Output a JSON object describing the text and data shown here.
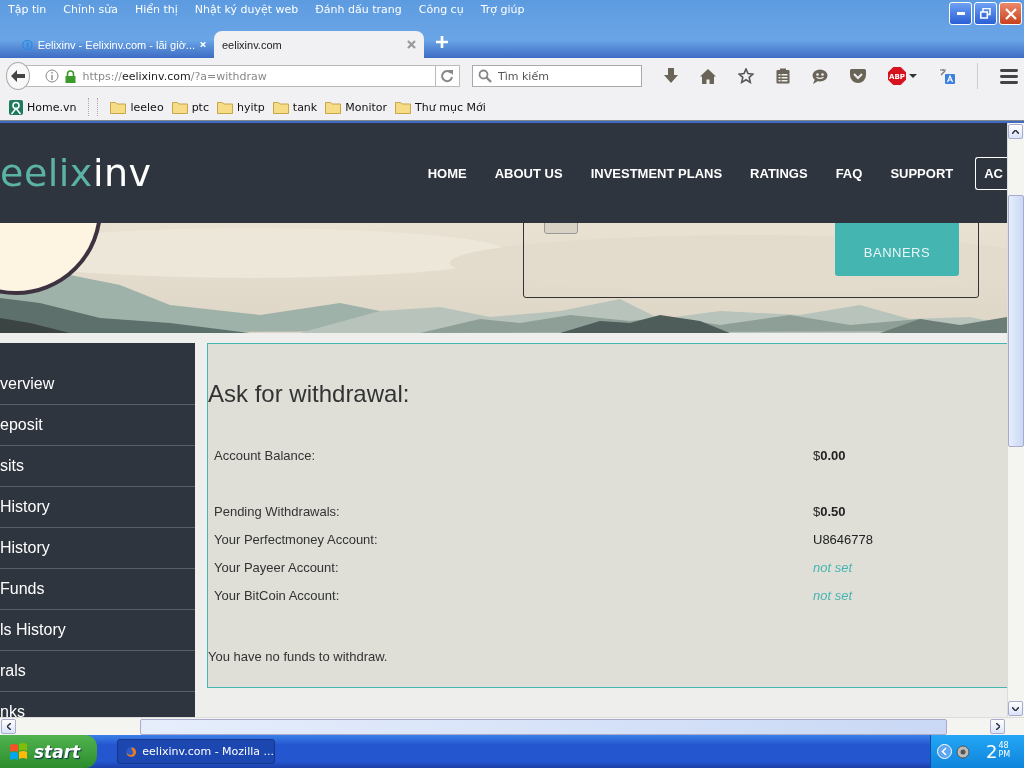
{
  "window": {
    "menus": [
      "Tập tin",
      "Chỉnh sửa",
      "Hiển thị",
      "Nhật ký duyệt web",
      "Đánh dấu trang",
      "Công cụ",
      "Trợ giúp"
    ]
  },
  "tabs": [
    {
      "label": "Eelixinv - Eelixinv.com - lãi giờ...",
      "selected": false
    },
    {
      "label": "eelixinv.com",
      "selected": true
    }
  ],
  "address_bar": {
    "scheme": "https://",
    "host": "eelixinv.com",
    "path": "/?a=withdraw"
  },
  "search": {
    "placeholder": "Tìm kiếm"
  },
  "toolbar": {
    "adblock_label": "ABP"
  },
  "bookmarks": [
    {
      "label": "Home.vn",
      "kind": "site"
    },
    {
      "label": "leeleo",
      "kind": "folder"
    },
    {
      "label": "ptc",
      "kind": "folder"
    },
    {
      "label": "hyitp",
      "kind": "folder"
    },
    {
      "label": "tank",
      "kind": "folder"
    },
    {
      "label": "Monitor",
      "kind": "folder"
    },
    {
      "label": "Thư mục Mới",
      "kind": "folder"
    }
  ],
  "site": {
    "logo_primary": "eelix",
    "logo_secondary": "inv",
    "nav": [
      "HOME",
      "ABOUT US",
      "INVESTMENT PLANS",
      "RATINGS",
      "FAQ",
      "SUPPORT"
    ],
    "account_button": "AC",
    "banners_button": "BANNERS"
  },
  "sidebar": {
    "items": [
      "verview",
      "eposit",
      "sits",
      "History",
      "History",
      "Funds",
      "ls History",
      "rals",
      "nks"
    ]
  },
  "withdraw": {
    "title": "Ask for withdrawal:",
    "rows": [
      {
        "label": "Account Balance:",
        "value": "$**0.00**",
        "kind": "amount"
      },
      {
        "label": "Pending Withdrawals:",
        "value": "$**0.50**",
        "kind": "amount"
      },
      {
        "label": "Your Perfectmoney Account:",
        "value": "U8646778",
        "kind": "text"
      },
      {
        "label": "Your Payeer Account:",
        "value": "not set",
        "kind": "unset"
      },
      {
        "label": "Your BitCoin Account:",
        "value": "not set",
        "kind": "unset"
      }
    ],
    "message": "You have no funds to withdraw."
  },
  "taskbar": {
    "start": "start",
    "tasks": [
      {
        "label": "eelixinv.com - Mozilla ...",
        "selected": true
      }
    ],
    "clock": {
      "hour": "2",
      "minute": "48",
      "period": "PM"
    }
  }
}
